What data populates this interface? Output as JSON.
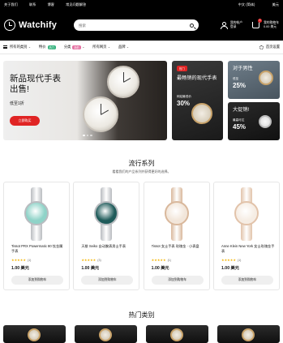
{
  "topbar": {
    "links": [
      "关于我们",
      "联系",
      "博客",
      "常见问题解答"
    ],
    "language": "中文 (简体)",
    "currency": "美元"
  },
  "header": {
    "brand": "Watchify",
    "search_placeholder": "搜索",
    "account_line1": "我的帐户",
    "account_line2": "登录",
    "cart_line1": "我的购物车",
    "cart_line2": "0.00 美元",
    "cart_count": "0"
  },
  "nav": {
    "items": [
      {
        "label": "所有的类别",
        "tag": ""
      },
      {
        "label": "特价",
        "tag": "热门"
      },
      {
        "label": "分类",
        "tag": "新的"
      },
      {
        "label": "所有网页",
        "tag": ""
      },
      {
        "label": "品牌",
        "tag": ""
      }
    ],
    "right_label": "首页设置"
  },
  "hero": {
    "title": "新品现代手表出售!",
    "subtitle": "低至1折",
    "button": "立即购买"
  },
  "promos": [
    {
      "badge": "热门",
      "title": "最畅销的现代手表",
      "small": "网站最低价",
      "pct": "30%"
    },
    {
      "title": "对于男性",
      "small": "低至",
      "pct": "25%"
    },
    {
      "title": "大促销!",
      "small": "最高可达",
      "pct": "45%"
    }
  ],
  "popular": {
    "title": "流行系列",
    "subtitle": "看看我们的产品系列并获得更好的选择。",
    "products": [
      {
        "name": "Tissot PRX Powermatic 80 钛金属手表",
        "stars": "★★★★★",
        "count": "(1)",
        "price": "1.00 美元",
        "button": "添加到购物车",
        "strap_color": "#b9bcc0",
        "dial_color": "#8fd3c8"
      },
      {
        "name": "天梭 Seiko 自动腕表男士手表",
        "stars": "★★★★★",
        "count": "(3)",
        "price": "1.00 美元",
        "button": "添加到购物车",
        "strap_color": "#b9bcc0",
        "dial_color": "#1f5b5a"
      },
      {
        "name": "Tissot 女士手表 玫瑰金 · 小表盘",
        "stars": "★★★★★",
        "count": "(1)",
        "price": "1.00 美元",
        "button": "添加到购物车",
        "strap_color": "#d9b89c",
        "dial_color": "#f2e6da"
      },
      {
        "name": "Anne Klein New York 女士玫瑰金手表",
        "stars": "★★★★★",
        "count": "(1)",
        "price": "1.00 美元",
        "button": "添加到购物车",
        "strap_color": "#e2c3aa",
        "dial_color": "#f6ede4"
      }
    ]
  },
  "hot": {
    "title": "热门类别"
  }
}
